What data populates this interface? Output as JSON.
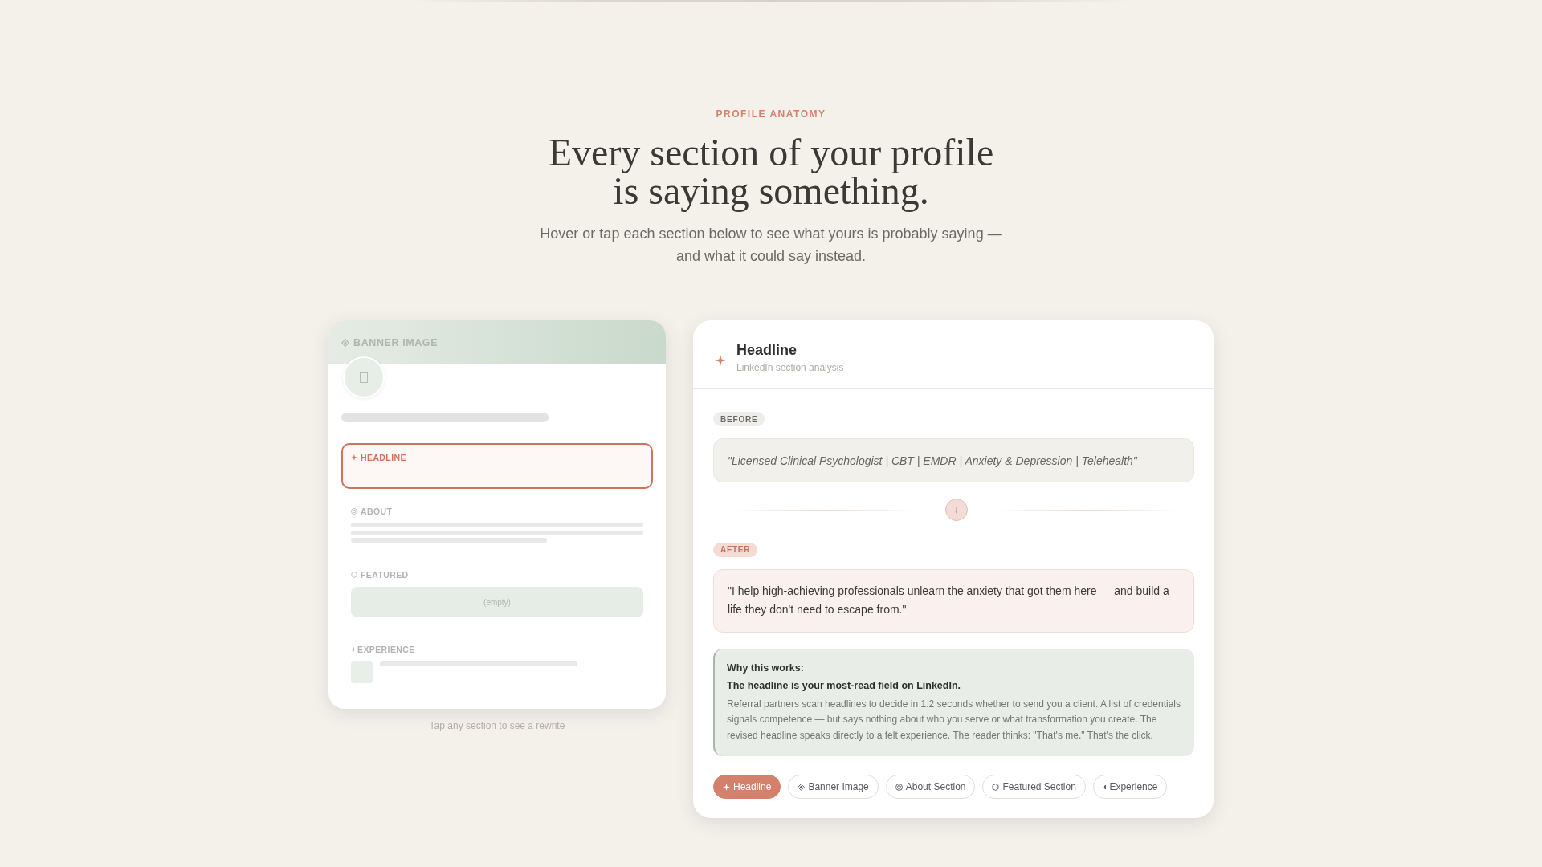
{
  "header": {
    "eyebrow": "PROFILE ANATOMY",
    "title": "Every section of your profile is saying something.",
    "subtitle": "Hover or tap each section below to see what yours is probably saying — and what it could say instead."
  },
  "profile_preview": {
    "sections": [
      {
        "kind": "banner",
        "label": "BANNER IMAGE",
        "selected": false
      },
      {
        "kind": "headline",
        "label": "HEADLINE",
        "selected": true
      },
      {
        "kind": "about",
        "label": "ABOUT",
        "selected": false
      },
      {
        "kind": "featured",
        "label": "FEATURED",
        "placeholder": "(empty)",
        "selected": false
      },
      {
        "kind": "experience",
        "label": "EXPERIENCE",
        "selected": false
      }
    ],
    "caption": "Tap any section to see a rewrite"
  },
  "analysis": {
    "title": "Headline",
    "subtitle": "LinkedIn section analysis",
    "before": {
      "badge": "BEFORE",
      "text": "\"Licensed Clinical Psychologist | CBT | EMDR | Anxiety & Depression | Telehealth\""
    },
    "transition_icon": "↓",
    "after": {
      "badge": "AFTER",
      "text": "\"I help high-achieving professionals unlearn the anxiety that got them here — and build a life they don't need to escape from.\""
    },
    "why": {
      "heading": "Why this works:",
      "lead": "The headline is your most-read field on LinkedIn.",
      "body": "Referral partners scan headlines to decide in 1.2 seconds whether to send you a client. A list of credentials signals competence — but says nothing about who you serve or what transformation you create. The revised headline speaks directly to a felt experience. The reader thinks: \"That's me.\" That's the click."
    },
    "section_tabs": [
      {
        "kind": "headline",
        "label": "Headline",
        "selected": true
      },
      {
        "kind": "banner",
        "label": "Banner Image",
        "selected": false
      },
      {
        "kind": "about",
        "label": "About Section",
        "selected": false
      },
      {
        "kind": "featured",
        "label": "Featured Section",
        "selected": false
      },
      {
        "kind": "experience",
        "label": "Experience",
        "selected": false
      }
    ]
  }
}
